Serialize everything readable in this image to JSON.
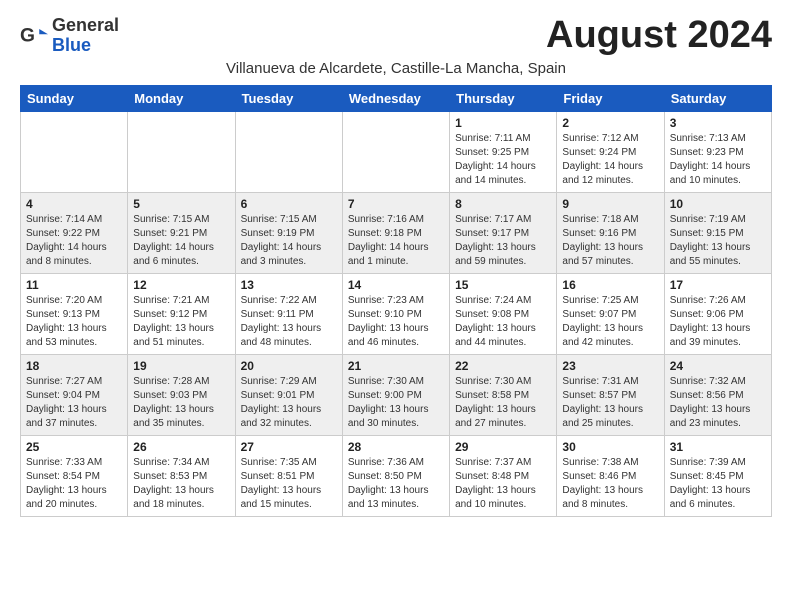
{
  "header": {
    "logo_general": "General",
    "logo_blue": "Blue",
    "month_title": "August 2024",
    "subtitle": "Villanueva de Alcardete, Castille-La Mancha, Spain"
  },
  "weekdays": [
    "Sunday",
    "Monday",
    "Tuesday",
    "Wednesday",
    "Thursday",
    "Friday",
    "Saturday"
  ],
  "weeks": [
    [
      {
        "day": "",
        "info": ""
      },
      {
        "day": "",
        "info": ""
      },
      {
        "day": "",
        "info": ""
      },
      {
        "day": "",
        "info": ""
      },
      {
        "day": "1",
        "info": "Sunrise: 7:11 AM\nSunset: 9:25 PM\nDaylight: 14 hours\nand 14 minutes."
      },
      {
        "day": "2",
        "info": "Sunrise: 7:12 AM\nSunset: 9:24 PM\nDaylight: 14 hours\nand 12 minutes."
      },
      {
        "day": "3",
        "info": "Sunrise: 7:13 AM\nSunset: 9:23 PM\nDaylight: 14 hours\nand 10 minutes."
      }
    ],
    [
      {
        "day": "4",
        "info": "Sunrise: 7:14 AM\nSunset: 9:22 PM\nDaylight: 14 hours\nand 8 minutes."
      },
      {
        "day": "5",
        "info": "Sunrise: 7:15 AM\nSunset: 9:21 PM\nDaylight: 14 hours\nand 6 minutes."
      },
      {
        "day": "6",
        "info": "Sunrise: 7:15 AM\nSunset: 9:19 PM\nDaylight: 14 hours\nand 3 minutes."
      },
      {
        "day": "7",
        "info": "Sunrise: 7:16 AM\nSunset: 9:18 PM\nDaylight: 14 hours\nand 1 minute."
      },
      {
        "day": "8",
        "info": "Sunrise: 7:17 AM\nSunset: 9:17 PM\nDaylight: 13 hours\nand 59 minutes."
      },
      {
        "day": "9",
        "info": "Sunrise: 7:18 AM\nSunset: 9:16 PM\nDaylight: 13 hours\nand 57 minutes."
      },
      {
        "day": "10",
        "info": "Sunrise: 7:19 AM\nSunset: 9:15 PM\nDaylight: 13 hours\nand 55 minutes."
      }
    ],
    [
      {
        "day": "11",
        "info": "Sunrise: 7:20 AM\nSunset: 9:13 PM\nDaylight: 13 hours\nand 53 minutes."
      },
      {
        "day": "12",
        "info": "Sunrise: 7:21 AM\nSunset: 9:12 PM\nDaylight: 13 hours\nand 51 minutes."
      },
      {
        "day": "13",
        "info": "Sunrise: 7:22 AM\nSunset: 9:11 PM\nDaylight: 13 hours\nand 48 minutes."
      },
      {
        "day": "14",
        "info": "Sunrise: 7:23 AM\nSunset: 9:10 PM\nDaylight: 13 hours\nand 46 minutes."
      },
      {
        "day": "15",
        "info": "Sunrise: 7:24 AM\nSunset: 9:08 PM\nDaylight: 13 hours\nand 44 minutes."
      },
      {
        "day": "16",
        "info": "Sunrise: 7:25 AM\nSunset: 9:07 PM\nDaylight: 13 hours\nand 42 minutes."
      },
      {
        "day": "17",
        "info": "Sunrise: 7:26 AM\nSunset: 9:06 PM\nDaylight: 13 hours\nand 39 minutes."
      }
    ],
    [
      {
        "day": "18",
        "info": "Sunrise: 7:27 AM\nSunset: 9:04 PM\nDaylight: 13 hours\nand 37 minutes."
      },
      {
        "day": "19",
        "info": "Sunrise: 7:28 AM\nSunset: 9:03 PM\nDaylight: 13 hours\nand 35 minutes."
      },
      {
        "day": "20",
        "info": "Sunrise: 7:29 AM\nSunset: 9:01 PM\nDaylight: 13 hours\nand 32 minutes."
      },
      {
        "day": "21",
        "info": "Sunrise: 7:30 AM\nSunset: 9:00 PM\nDaylight: 13 hours\nand 30 minutes."
      },
      {
        "day": "22",
        "info": "Sunrise: 7:30 AM\nSunset: 8:58 PM\nDaylight: 13 hours\nand 27 minutes."
      },
      {
        "day": "23",
        "info": "Sunrise: 7:31 AM\nSunset: 8:57 PM\nDaylight: 13 hours\nand 25 minutes."
      },
      {
        "day": "24",
        "info": "Sunrise: 7:32 AM\nSunset: 8:56 PM\nDaylight: 13 hours\nand 23 minutes."
      }
    ],
    [
      {
        "day": "25",
        "info": "Sunrise: 7:33 AM\nSunset: 8:54 PM\nDaylight: 13 hours\nand 20 minutes."
      },
      {
        "day": "26",
        "info": "Sunrise: 7:34 AM\nSunset: 8:53 PM\nDaylight: 13 hours\nand 18 minutes."
      },
      {
        "day": "27",
        "info": "Sunrise: 7:35 AM\nSunset: 8:51 PM\nDaylight: 13 hours\nand 15 minutes."
      },
      {
        "day": "28",
        "info": "Sunrise: 7:36 AM\nSunset: 8:50 PM\nDaylight: 13 hours\nand 13 minutes."
      },
      {
        "day": "29",
        "info": "Sunrise: 7:37 AM\nSunset: 8:48 PM\nDaylight: 13 hours\nand 10 minutes."
      },
      {
        "day": "30",
        "info": "Sunrise: 7:38 AM\nSunset: 8:46 PM\nDaylight: 13 hours\nand 8 minutes."
      },
      {
        "day": "31",
        "info": "Sunrise: 7:39 AM\nSunset: 8:45 PM\nDaylight: 13 hours\nand 6 minutes."
      }
    ]
  ]
}
